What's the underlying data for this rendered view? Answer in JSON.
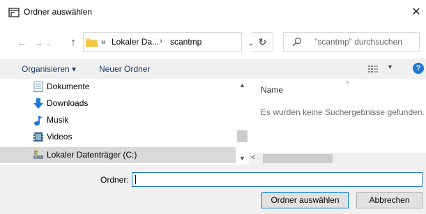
{
  "window": {
    "title": "Ordner auswählen",
    "close_glyph": "✕"
  },
  "nav": {
    "back_glyph": "←",
    "forward_glyph": "→",
    "recent_glyph": "⌄",
    "up_glyph": "↑",
    "address": {
      "overflow_glyph": "«",
      "segment1": "Lokaler Da...",
      "separator": "›",
      "segment2": "scantmp",
      "dropdown_glyph": "⌄"
    },
    "refresh_glyph": "↻",
    "search_placeholder": "\"scantmp\" durchsuchen"
  },
  "toolbar": {
    "organize_label": "Organisieren ▾",
    "new_folder_label": "Neuer Ordner",
    "view_dropdown_glyph": "▾",
    "help_label": "?"
  },
  "sidebar": {
    "items": [
      {
        "label": "Dokumente",
        "icon": "documents-icon"
      },
      {
        "label": "Downloads",
        "icon": "downloads-icon"
      },
      {
        "label": "Musik",
        "icon": "music-icon"
      },
      {
        "label": "Videos",
        "icon": "videos-icon"
      },
      {
        "label": "Lokaler Datenträger (C:)",
        "icon": "drive-icon",
        "selected": true
      }
    ],
    "scroll_up_glyph": "▲",
    "scroll_down_glyph": "▼"
  },
  "content": {
    "column_name": "Name",
    "sort_glyph": "˄",
    "empty_message": "Es wurden keine Suchergebnisse gefunden.",
    "hscroll_left_glyph": "<"
  },
  "footer": {
    "folder_label": "Ordner:",
    "folder_value": "",
    "ok_label": "Ordner auswählen",
    "cancel_label": "Abbrechen"
  },
  "colors": {
    "accent": "#1e78d7",
    "selected": "#d9d9d9",
    "folder": "#f8d775"
  }
}
